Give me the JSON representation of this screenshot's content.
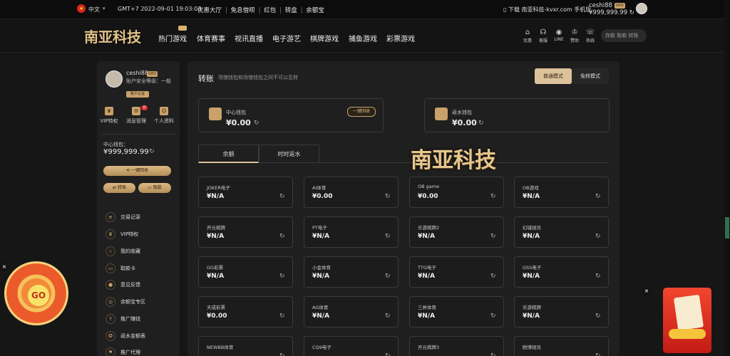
{
  "topbar": {
    "lang": "中文",
    "clock": "GMT+7 2022-09-01 19:03:03",
    "links": [
      "优惠大厅",
      "免息借呗",
      "红包",
      "转盘",
      "余额宝"
    ],
    "download": "下载 南亚科技-kvxr.com 手机版",
    "username": "ceshi88",
    "vip": "VIP2",
    "balance": "¥999,999.99"
  },
  "nav": {
    "logo": "南亚科技",
    "items": [
      "热门游戏",
      "体育赛事",
      "视讯直播",
      "电子游艺",
      "棋牌游戏",
      "捕鱼游戏",
      "彩票游戏"
    ],
    "quick_icons": [
      {
        "label": "优惠",
        "icon": "gift-icon"
      },
      {
        "label": "客服",
        "icon": "headset-icon"
      },
      {
        "label": "LINE",
        "icon": "chat-icon"
      },
      {
        "label": "赞助",
        "icon": "trophy-icon"
      },
      {
        "label": "热线",
        "icon": "phone-icon"
      }
    ],
    "search_placeholder": "存款 取款 转账"
  },
  "profile": {
    "name": "ceshi88",
    "vip": "VIP2",
    "security": "账户安全等级：一般",
    "badge": "账户认证",
    "icons": [
      {
        "label": "VIP特权",
        "badge": ""
      },
      {
        "label": "消息管理",
        "badge": "0"
      },
      {
        "label": "个人资料",
        "badge": ""
      }
    ],
    "wallet_label": "中心钱包：",
    "wallet_value": "¥999,999.99",
    "recall_all": "一键回收",
    "transfer": "转账",
    "withdraw": "取款",
    "menu": [
      "交易记录",
      "VIP特权",
      "我的收藏",
      "取款卡",
      "意见反馈",
      "余额宝专区",
      "推广赚钱",
      "返水金额表",
      "推广代理"
    ]
  },
  "transfer": {
    "title": "转账",
    "subtitle": "场馆钱包和场馆钱包之间不可以互转",
    "modes": [
      "普通模式",
      "免转模式"
    ],
    "center_wallet": {
      "name": "中心钱包",
      "amount": "¥0.00",
      "recall": "一键回收"
    },
    "rebate_wallet": {
      "name": "返水钱包",
      "amount": "¥0.00"
    },
    "tabs": [
      "余额",
      "时时返水"
    ],
    "watermark": "南亚科技",
    "games": [
      {
        "name": "JOKER电子",
        "value": "¥N/A"
      },
      {
        "name": "AI体育",
        "value": "¥0.00"
      },
      {
        "name": "OB game",
        "value": "¥0.00"
      },
      {
        "name": "OB游戏",
        "value": "¥N/A"
      },
      {
        "name": "开元棋牌",
        "value": "¥N/A"
      },
      {
        "name": "PT电子",
        "value": "¥N/A"
      },
      {
        "name": "乐游棋牌2",
        "value": "¥N/A"
      },
      {
        "name": "幻城视讯",
        "value": "¥N/A"
      },
      {
        "name": "GG彩票",
        "value": "¥N/A"
      },
      {
        "name": "小金体育",
        "value": "¥N/A"
      },
      {
        "name": "TTG电子",
        "value": "¥N/A"
      },
      {
        "name": "GSS电子",
        "value": "¥N/A"
      },
      {
        "name": "天成彩票",
        "value": "¥0.00"
      },
      {
        "name": "AG体育",
        "value": "¥N/A"
      },
      {
        "name": "三昇体育",
        "value": "¥N/A"
      },
      {
        "name": "乐游棋牌",
        "value": "¥N/A"
      },
      {
        "name": "NEWBB体育",
        "value": ""
      },
      {
        "name": "CQ9电子",
        "value": ""
      },
      {
        "name": "开元棋牌3",
        "value": ""
      },
      {
        "name": "欧博视讯",
        "value": ""
      }
    ]
  },
  "promo": {
    "wheel": "GO"
  },
  "colors": {
    "accent": "#dcc29a",
    "gold": "#c9a16a",
    "bg": "#161616",
    "panel": "#1f1f1f"
  }
}
